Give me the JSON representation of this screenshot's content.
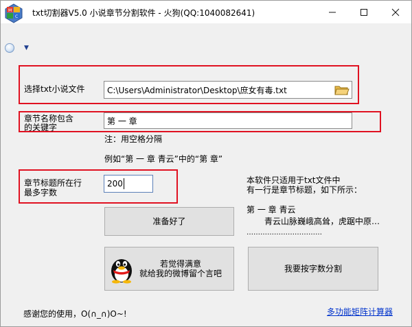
{
  "window": {
    "title": "txt切割器V5.0 小说章节分割软件 - 火狗(QQ:1040082641)",
    "controls": {
      "minimize": "—",
      "maximize": "☐",
      "close": "✕"
    }
  },
  "form": {
    "file_label": "选择txt小说文件",
    "file_path": "C:\\Users\\Administrator\\Desktop\\庶女有毒.txt",
    "keyword_label_line1": "章节名称包含",
    "keyword_label_line2": "的关键字",
    "keyword_value": "第 一 章",
    "hint_space": "注：用空格分隔",
    "hint_example": "例如“第 一 章   青云”中的“第  章”",
    "maxchars_label_line1": "章节标题所在行",
    "maxchars_label_line2": "最多字数",
    "maxchars_value": "200"
  },
  "info": {
    "line1": "本软件只适用于txt文件中",
    "line2": "有一行是章节标题，如下所示：",
    "example_title": "第 一 章   青云",
    "example_body": "青云山脉巍峨高耸，虎踞中原…",
    "dots": "……………………………"
  },
  "buttons": {
    "ready": "准备好了",
    "feedback_line1": "若觉得满意",
    "feedback_line2": "就给我的微博留个言吧",
    "split_by_chars": "我要按字数分割"
  },
  "footer": {
    "thanks": "感谢您的使用，O(∩_∩)O~!",
    "link": "多功能矩阵计算器"
  },
  "colors": {
    "highlight_box": "#e01020",
    "link": "#0033cc"
  }
}
